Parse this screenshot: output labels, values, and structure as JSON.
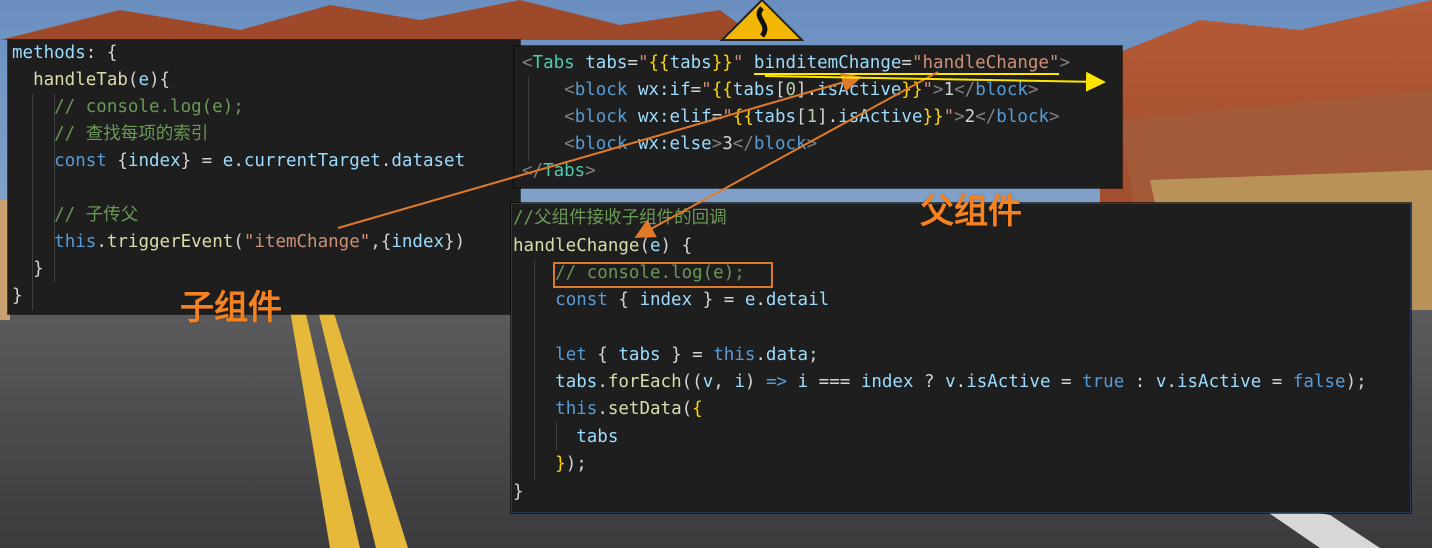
{
  "child_panel": {
    "lines": [
      "methods: {",
      "  handleTab(e){",
      "    // console.log(e);",
      "    // 查找每项的索引",
      "    const {index} = e.currentTarget.dataset",
      "",
      "    // 子传父",
      "    this.triggerEvent(\"itemChange\",{index})",
      "  }",
      "}"
    ],
    "label": "子组件"
  },
  "tabs_panel": {
    "lines": [
      "<Tabs tabs=\"{{tabs}}\" binditemChange=\"handleChange\">",
      "    <block wx:if=\"{{tabs[0].isActive}}\">1</block>",
      "    <block wx:elif=\"{{tabs[1].isActive}}\">2</block>",
      "    <block wx:else>3</block>",
      "</Tabs>"
    ]
  },
  "handler_panel": {
    "lines": [
      "//父组件接收子组件的回调",
      "handleChange(e) {",
      "    // console.log(e);",
      "    const { index } = e.detail",
      "",
      "    let { tabs } = this.data;",
      "    tabs.forEach((v, i) => i === index ? v.isActive = true : v.isActive = false);",
      "    this.setData({",
      "      tabs",
      "    });",
      "}"
    ],
    "label": "父组件"
  },
  "colors": {
    "label_orange": "#f58220",
    "arrow_orange": "#e07a2a",
    "arrow_yellow": "#ffe600",
    "editor_bg": "#1e1e1e"
  },
  "background": {
    "description_icons": [
      "winding-road-sign-icon"
    ]
  }
}
